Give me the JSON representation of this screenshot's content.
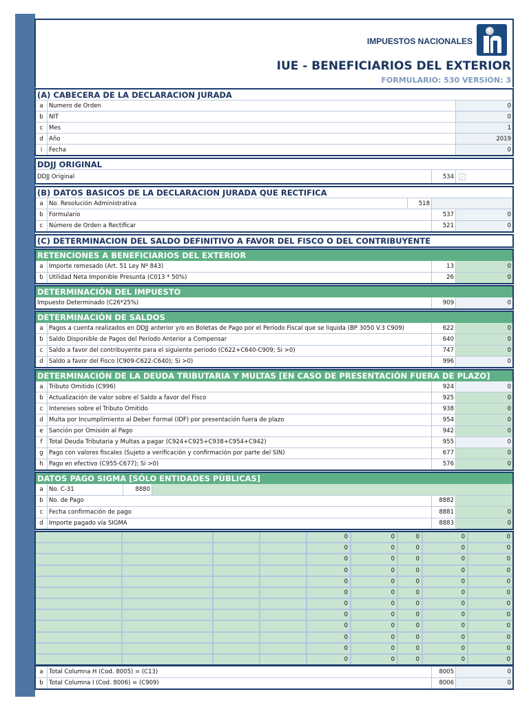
{
  "header": {
    "brand": "IMPUESTOS NACIONALES",
    "title": "IUE - BENEFICIARIOS DEL EXTERIOR",
    "version": "FORMULARIO: 530 VERSIÓN: 3"
  },
  "colors": {
    "navy": "#1c3d6e",
    "green_header": "#5fb086",
    "input_green": "#c9e4d1",
    "computed_gray": "#edf2f7",
    "strip": "#4d77a2"
  },
  "sections": [
    {
      "title": "(A) CABECERA DE LA DECLARACION JURADA",
      "style": "white",
      "rows": [
        {
          "letter": "a",
          "label": "Numero de Orden",
          "value": "0",
          "fill": "gray"
        },
        {
          "letter": "b",
          "label": "NIT",
          "value": "0",
          "fill": "gray"
        },
        {
          "letter": "c",
          "label": "Mes",
          "value": "1",
          "fill": "gray"
        },
        {
          "letter": "d",
          "label": "Año",
          "value": "2019",
          "fill": "gray"
        },
        {
          "letter": "i",
          "label": "Fecha",
          "value": "0",
          "fill": "gray"
        }
      ]
    },
    {
      "title": "DDJJ ORIGINAL",
      "style": "white",
      "rows": [
        {
          "label": "DDJJ Original",
          "code": "534",
          "variant": "checkbox",
          "checked": true
        }
      ]
    },
    {
      "title": "(B) DATOS BASICOS DE LA DECLARACION JURADA QUE RECTIFICA",
      "style": "white",
      "rows": [
        {
          "letter": "a",
          "label": "No. Resolución Administrativa",
          "code": "518",
          "value": "",
          "fill": "gray",
          "variant": "wide"
        },
        {
          "letter": "b",
          "label": "Formulario",
          "code": "537",
          "value": "0",
          "fill": "gray"
        },
        {
          "letter": "c",
          "label": "Número de Orden a Rectificar",
          "code": "521",
          "value": "0",
          "fill": "gray"
        }
      ]
    },
    {
      "title": "(C) DETERMINACION DEL SALDO DEFINITIVO A FAVOR DEL FISCO O DEL CONTRIBUYENTE",
      "style": "white",
      "rows": []
    },
    {
      "title": "RETENCIONES A BENEFICIARIOS DEL EXTERIOR",
      "style": "green",
      "rows": [
        {
          "letter": "a",
          "label": "Importe remesado (Art. 51 Ley Nº 843)",
          "code": "13",
          "value": "0",
          "fill": "green"
        },
        {
          "letter": "b",
          "label": "Utilidad Neta Imponible Presunta (C013 * 50%)",
          "code": "26",
          "value": "0",
          "fill": "green"
        }
      ]
    },
    {
      "title": "DETERMINACIÓN DEL IMPUESTO",
      "style": "green",
      "rows": [
        {
          "label": "Impuesto Determinado (C26*25%)",
          "code": "909",
          "value": "0",
          "fill": "gray"
        }
      ]
    },
    {
      "title": "DETERMINACIÓN DE SALDOS",
      "style": "green",
      "rows": [
        {
          "letter": "a",
          "label": "Pagos a cuenta realizados en DDJJ anterior y/o en Boletas de Pago por el Período Fiscal que se liquida (BP 3050 V.3 C909)",
          "code": "622",
          "value": "0",
          "fill": "green"
        },
        {
          "letter": "b",
          "label": "Saldo Disponible de Pagos del Período Anterior a Compensar",
          "code": "640",
          "value": "0",
          "fill": "green"
        },
        {
          "letter": "c",
          "label": "Saldo a favor del contribuyente para el siguiente periodo (C622+C640-C909; Si >0)",
          "code": "747",
          "value": "0",
          "fill": "green"
        },
        {
          "letter": "d",
          "label": "Saldo a favor del Fisco (C909-C622-C640); Si >0)",
          "code": "996",
          "value": "0",
          "fill": "gray"
        }
      ]
    },
    {
      "title": "DETERMINACIÓN DE LA DEUDA TRIBUTARIA Y MULTAS [EN CASO DE PRESENTACIÓN FUERA DE PLAZO]",
      "style": "green",
      "rows": [
        {
          "letter": "a",
          "label": "Tributo Omitido (C996)",
          "code": "924",
          "value": "0",
          "fill": "gray"
        },
        {
          "letter": "b",
          "label": "Actualización de valor sobre el Saldo a favor del Fisco",
          "code": "925",
          "value": "0",
          "fill": "green"
        },
        {
          "letter": "c",
          "label": "Intereses sobre el Tributo Omitido",
          "code": "938",
          "value": "0",
          "fill": "green"
        },
        {
          "letter": "d",
          "label": "Multa por Incumplimiento al Deber Formal (IDF) por presentación fuera de plazo",
          "code": "954",
          "value": "0",
          "fill": "green"
        },
        {
          "letter": "e",
          "label": "Sanción por Omisión al Pago",
          "code": "942",
          "value": "0",
          "fill": "green"
        },
        {
          "letter": "f",
          "label": "Total Deuda Tributaria y Multas a pagar (C924+C925+C938+C954+C942)",
          "code": "955",
          "value": "0",
          "fill": "gray"
        },
        {
          "letter": "g",
          "label": "Pago con valores fiscales (Sujeto a verificación y confirmación por parte del SIN)",
          "code": "677",
          "value": "0",
          "fill": "green"
        },
        {
          "letter": "h",
          "label": "Pago en efectivo (C955-C677); Si >0)",
          "code": "576",
          "value": "0",
          "fill": "green"
        }
      ]
    },
    {
      "title": "DATOS PAGO SIGMA [SÓLO ENTIDADES PÚBLICAS]",
      "style": "green",
      "rows": [
        {
          "letter": "a",
          "label": "No. C-31",
          "code": "8880",
          "value": "",
          "fill": "green",
          "variant": "short"
        },
        {
          "letter": "b",
          "label": "No. de Pago",
          "code": "8882",
          "value": "",
          "fill": "green"
        },
        {
          "letter": "c",
          "label": "Fecha confirmación de pago",
          "code": "8881",
          "value": "0",
          "fill": "green"
        },
        {
          "letter": "d",
          "label": "Importe pagado vía SIGMA",
          "code": "8883",
          "value": "0",
          "fill": "green"
        }
      ]
    }
  ],
  "grid": {
    "rows": [
      [
        "",
        "",
        "",
        "",
        "0",
        "0",
        "0",
        "0",
        "0"
      ],
      [
        "",
        "",
        "",
        "",
        "0",
        "0",
        "0",
        "0",
        "0"
      ],
      [
        "",
        "",
        "",
        "",
        "0",
        "0",
        "0",
        "0",
        "0"
      ],
      [
        "",
        "",
        "",
        "",
        "0",
        "0",
        "0",
        "0",
        "0"
      ],
      [
        "",
        "",
        "",
        "",
        "0",
        "0",
        "0",
        "0",
        "0"
      ],
      [
        "",
        "",
        "",
        "",
        "0",
        "0",
        "0",
        "0",
        "0"
      ],
      [
        "",
        "",
        "",
        "",
        "0",
        "0",
        "0",
        "0",
        "0"
      ],
      [
        "",
        "",
        "",
        "",
        "0",
        "0",
        "0",
        "0",
        "0"
      ],
      [
        "",
        "",
        "",
        "",
        "0",
        "0",
        "0",
        "0",
        "0"
      ],
      [
        "",
        "",
        "",
        "",
        "0",
        "0",
        "0",
        "0",
        "0"
      ],
      [
        "",
        "",
        "",
        "",
        "0",
        "0",
        "0",
        "0",
        "0"
      ],
      [
        "",
        "",
        "",
        "",
        "0",
        "0",
        "0",
        "0",
        "0"
      ]
    ]
  },
  "totals": {
    "rows": [
      {
        "letter": "a",
        "label": "Total Columna H (Cod. 8005) = (C13)",
        "code": "8005",
        "value": "0",
        "fill": "gray"
      },
      {
        "letter": "b",
        "label": "Total Columna I (Cod. 8006) = (C909)",
        "code": "8006",
        "value": "0",
        "fill": "gray"
      }
    ]
  }
}
